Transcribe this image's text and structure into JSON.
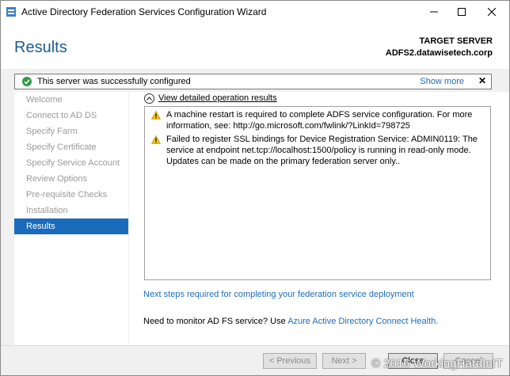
{
  "window": {
    "title": "Active Directory Federation Services Configuration Wizard"
  },
  "header": {
    "page_title": "Results",
    "target_label": "TARGET SERVER",
    "target_value": "ADFS2.datawisetech.corp"
  },
  "status": {
    "text": "This server was successfully configured",
    "show_more": "Show more",
    "close": "✕",
    "color": "#2e9c3e"
  },
  "sidebar": {
    "items": [
      {
        "label": "Welcome",
        "active": false
      },
      {
        "label": "Connect to AD DS",
        "active": false
      },
      {
        "label": "Specify Farm",
        "active": false
      },
      {
        "label": "Specify Certificate",
        "active": false
      },
      {
        "label": "Specify Service Account",
        "active": false
      },
      {
        "label": "Review Options",
        "active": false
      },
      {
        "label": "Pre-requisite Checks",
        "active": false
      },
      {
        "label": "Installation",
        "active": false
      },
      {
        "label": "Results",
        "active": true
      }
    ]
  },
  "content": {
    "view_details": "View detailed operation results",
    "messages": [
      {
        "icon": "warning-icon",
        "text": "A machine restart is required to complete ADFS service configuration. For more information, see: http://go.microsoft.com/fwlink/?LinkId=798725"
      },
      {
        "icon": "warning-icon",
        "text": "Failed to register SSL bindings for Device Registration Service: ADMIN0119: The service at endpoint net.tcp://localhost:1500/policy is running in read-only mode. Updates can be made on the primary federation server only.."
      }
    ],
    "next_steps": "Next steps required for completing your federation service deployment",
    "monitor_prefix": "Need to monitor AD FS service? Use ",
    "monitor_link": "Azure Active Directory Connect Health."
  },
  "footer": {
    "previous": "< Previous",
    "next": "Next >",
    "close": "Close",
    "cancel": "Cancel"
  },
  "watermark": "© 2016 WorkingHardInIT",
  "colors": {
    "accent": "#1b6bbd",
    "title_blue": "#1e5b8e",
    "link": "#1e6dbd"
  }
}
